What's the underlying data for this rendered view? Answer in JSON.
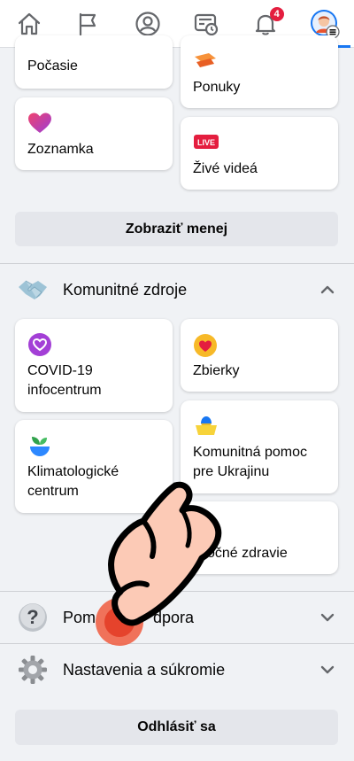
{
  "nav": {
    "notification_count": "4",
    "items": [
      "home-icon",
      "flag-icon",
      "profile-icon",
      "feed-icon",
      "bell-icon",
      "menu-avatar-icon"
    ]
  },
  "shortcuts": {
    "pocasie": "Počasie",
    "ponuky": "Ponuky",
    "zoznamka": "Zoznamka",
    "live_badge": "LIVE",
    "zive_videa": "Živé videá",
    "show_less": "Zobraziť menej"
  },
  "community": {
    "title": "Komunitné zdroje",
    "covid": "COVID-19 infocentrum",
    "zbierky": "Zbierky",
    "ukraine": "Komunitná pomoc pre Ukrajinu",
    "climate": "Klimatologické centrum",
    "mental": "Duševné zdravie",
    "mental_visible": "očné zdravie"
  },
  "sections": {
    "help": "Pomoc a podpora",
    "help_visible_left": "Pom",
    "help_visible_right": "dpora",
    "settings": "Nastavenia a súkromie"
  },
  "logout": "Odhlásiť sa",
  "colors": {
    "accent": "#1877f2",
    "badge": "#e41e3f",
    "background": "#f0f2f5"
  }
}
